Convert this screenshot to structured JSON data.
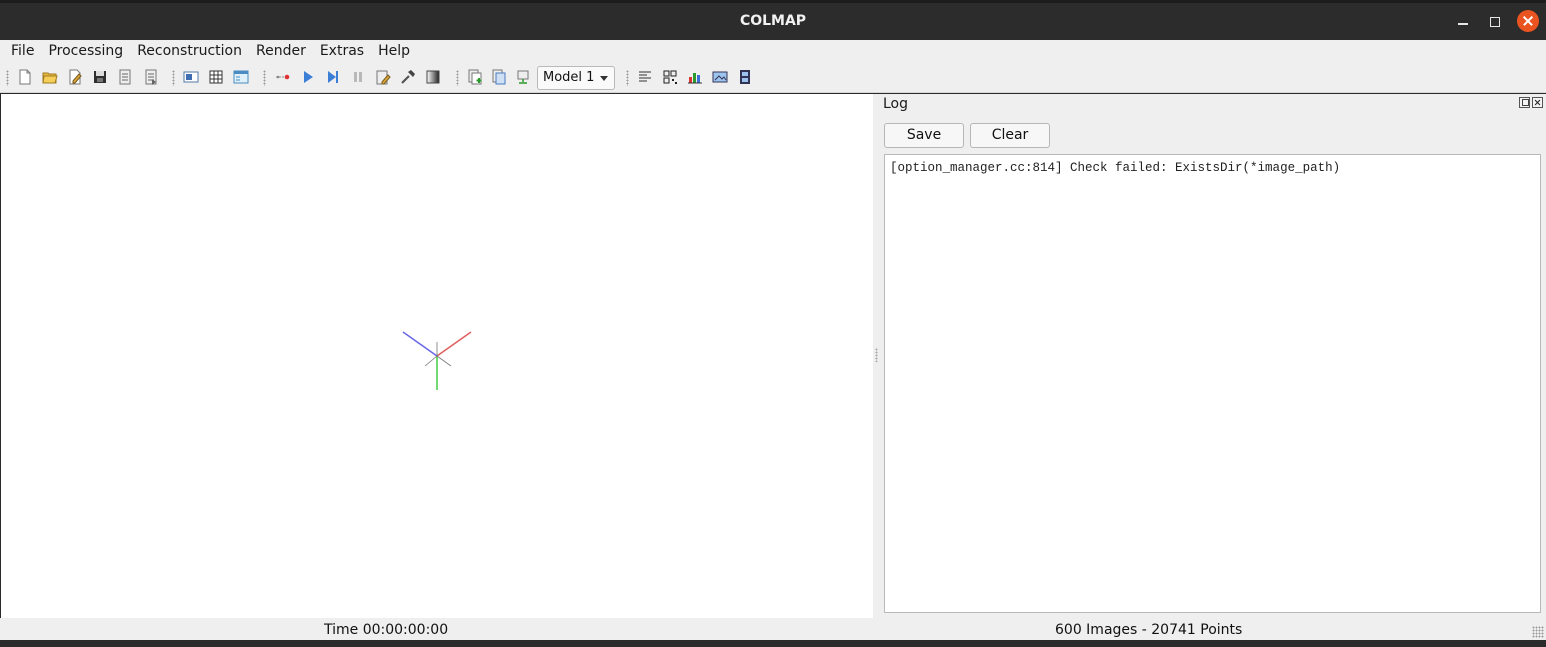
{
  "window": {
    "title": "COLMAP"
  },
  "menu": {
    "items": [
      "File",
      "Processing",
      "Reconstruction",
      "Render",
      "Extras",
      "Help"
    ]
  },
  "toolbar": {
    "model_select": {
      "selected": "Model 1"
    },
    "icons": [
      "new-project-icon",
      "open-project-icon",
      "edit-project-icon",
      "save-project-icon",
      "import-model-icon",
      "export-model-icon",
      "feature-extraction-icon",
      "feature-matching-icon",
      "database-management-icon",
      "reconstruction-options-icon",
      "start-reconstruction-icon",
      "step-reconstruction-icon",
      "pause-reconstruction-icon",
      "reconstruction-bundle-adjustment-icon",
      "reconstruction-tools-icon",
      "normalize-icon",
      "undistort-icon",
      "dense-reconstruction-icon",
      "render-options-icon",
      "reconstruction-stats-icon",
      "match-matrix-icon",
      "show-log-icon",
      "grab-image-icon",
      "grab-movie-icon"
    ]
  },
  "log": {
    "title": "Log",
    "save_label": "Save",
    "clear_label": "Clear",
    "text": "[option_manager.cc:814] Check failed: ExistsDir(*image_path)"
  },
  "status": {
    "time": "Time 00:00:00:00",
    "count": "600 Images - 20741 Points"
  },
  "colors": {
    "titlebar": "#2c2c2c",
    "close_button": "#e95420",
    "axis_x": "#e06060",
    "axis_y": "#4fd14f",
    "axis_z": "#6a6ae6"
  }
}
